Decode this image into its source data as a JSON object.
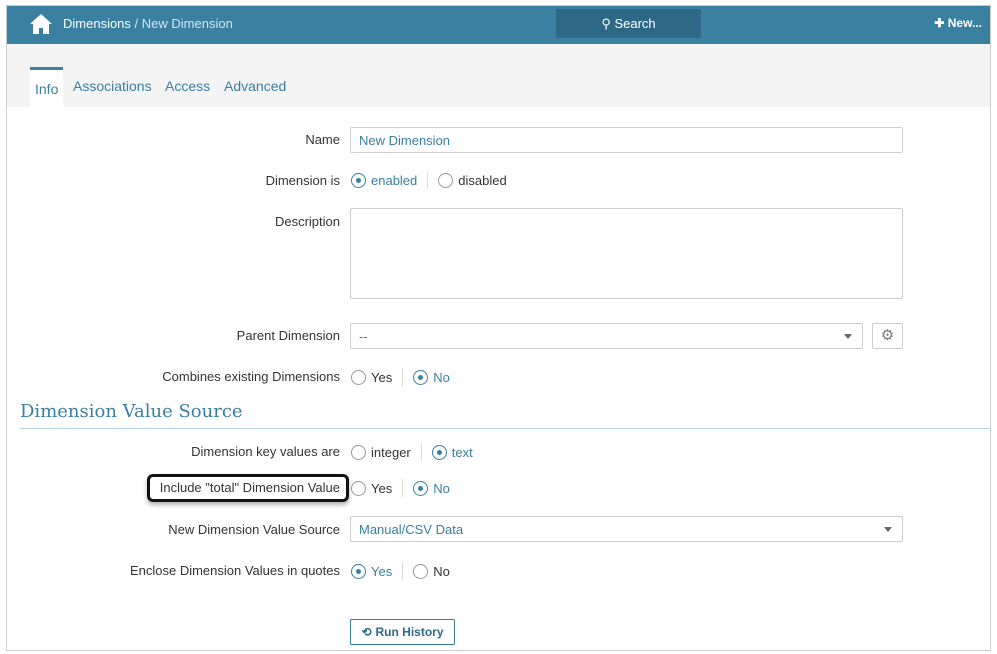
{
  "header": {
    "breadcrumb_root": "Dimensions",
    "breadcrumb_sep": " / ",
    "breadcrumb_current": "New Dimension",
    "search_label": "Search",
    "new_label": "New..."
  },
  "tabs": [
    {
      "label": "Info"
    },
    {
      "label": "Associations"
    },
    {
      "label": "Access"
    },
    {
      "label": "Advanced"
    }
  ],
  "form": {
    "name_label": "Name",
    "name_value": "New Dimension",
    "status_label": "Dimension is",
    "status_options": [
      "enabled",
      "disabled"
    ],
    "description_label": "Description",
    "description_value": "",
    "parent_label": "Parent Dimension",
    "parent_value": "--",
    "combines_label": "Combines existing Dimensions",
    "yes": "Yes",
    "no": "No"
  },
  "section": {
    "title": "Dimension Value Source",
    "key_label": "Dimension key values are",
    "key_options": [
      "integer",
      "text"
    ],
    "total_label": "Include \"total\" Dimension Value",
    "source_label": "New Dimension Value Source",
    "source_value": "Manual/CSV Data",
    "quotes_label": "Enclose Dimension Values in quotes",
    "run_history": "Run History"
  },
  "colors": {
    "header": "#3a80a1",
    "accent": "#3a7fa0"
  }
}
